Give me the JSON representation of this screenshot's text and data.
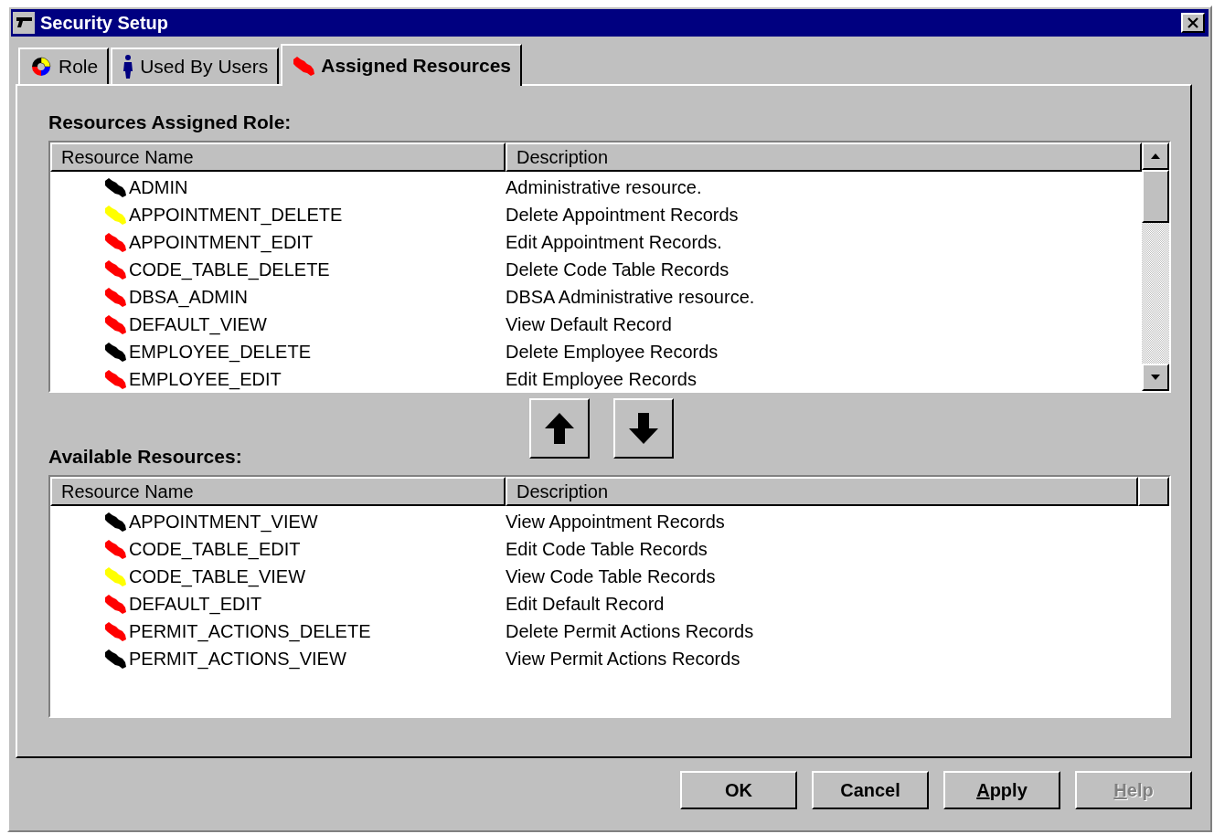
{
  "window": {
    "title": "Security Setup"
  },
  "tabs": [
    {
      "label": "Role",
      "selected": false
    },
    {
      "label": "Used By Users",
      "selected": false
    },
    {
      "label": "Assigned Resources",
      "selected": true
    }
  ],
  "assigned": {
    "heading": "Resources Assigned Role:",
    "columns": [
      "Resource Name",
      "Description"
    ],
    "rows": [
      {
        "name": "ADMIN",
        "description": "Administrative resource.",
        "color": "#000000"
      },
      {
        "name": "APPOINTMENT_DELETE",
        "description": "Delete Appointment Records",
        "color": "#ffff00"
      },
      {
        "name": "APPOINTMENT_EDIT",
        "description": "Edit Appointment Records.",
        "color": "#ff0000"
      },
      {
        "name": "CODE_TABLE_DELETE",
        "description": "Delete Code Table Records",
        "color": "#ff0000"
      },
      {
        "name": "DBSA_ADMIN",
        "description": "DBSA Administrative resource.",
        "color": "#ff0000"
      },
      {
        "name": "DEFAULT_VIEW",
        "description": "View Default  Record",
        "color": "#ff0000"
      },
      {
        "name": "EMPLOYEE_DELETE",
        "description": "Delete  Employee Records",
        "color": "#000000"
      },
      {
        "name": "EMPLOYEE_EDIT",
        "description": "Edit Employee Records",
        "color": "#ff0000"
      }
    ]
  },
  "available": {
    "heading": "Available Resources:",
    "columns": [
      "Resource Name",
      "Description"
    ],
    "rows": [
      {
        "name": "APPOINTMENT_VIEW",
        "description": "View Appointment Records",
        "color": "#000000"
      },
      {
        "name": "CODE_TABLE_EDIT",
        "description": "Edit Code Table Records",
        "color": "#ff0000"
      },
      {
        "name": "CODE_TABLE_VIEW",
        "description": "View Code Table Records",
        "color": "#ffff00"
      },
      {
        "name": "DEFAULT_EDIT",
        "description": "Edit Default Record",
        "color": "#ff0000"
      },
      {
        "name": "PERMIT_ACTIONS_DELETE",
        "description": "Delete Permit Actions Records",
        "color": "#ff0000"
      },
      {
        "name": "PERMIT_ACTIONS_VIEW",
        "description": "View Permit Actions Records",
        "color": "#000000"
      }
    ]
  },
  "buttons": [
    {
      "label": "OK",
      "underline_first": false,
      "disabled": false
    },
    {
      "label": "Cancel",
      "underline_first": false,
      "disabled": false
    },
    {
      "label": "Apply",
      "underline_first": true,
      "disabled": false
    },
    {
      "label": "Help",
      "underline_first": true,
      "disabled": true
    }
  ]
}
